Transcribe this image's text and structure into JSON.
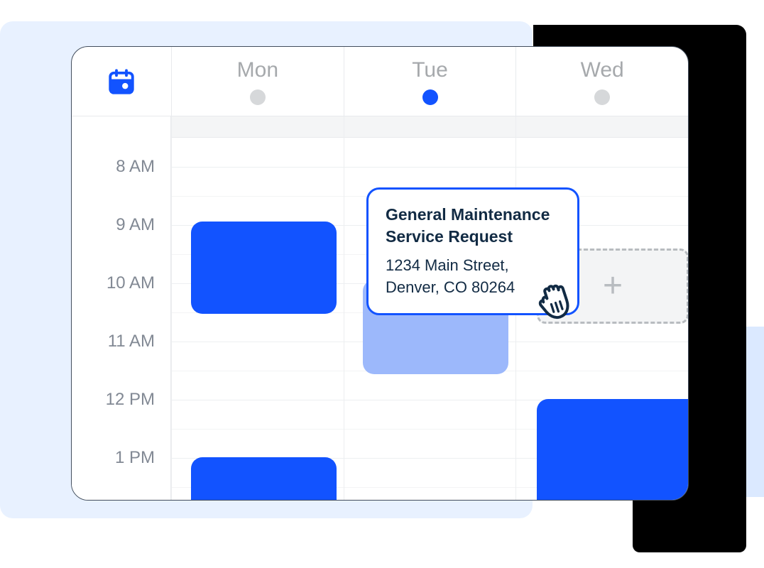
{
  "days": [
    {
      "label": "Mon",
      "active": false
    },
    {
      "label": "Tue",
      "active": true
    },
    {
      "label": "Wed",
      "active": false
    }
  ],
  "timeLabels": [
    "8 AM",
    "9 AM",
    "10 AM",
    "11 AM",
    "12 PM",
    "1 PM"
  ],
  "popover": {
    "title": "General Maintenance Service Request",
    "address": "1234 Main Street, Denver, CO 80264"
  },
  "colors": {
    "primary": "#1253FF",
    "muted": "#A6A9AC",
    "text": "#122B44"
  }
}
